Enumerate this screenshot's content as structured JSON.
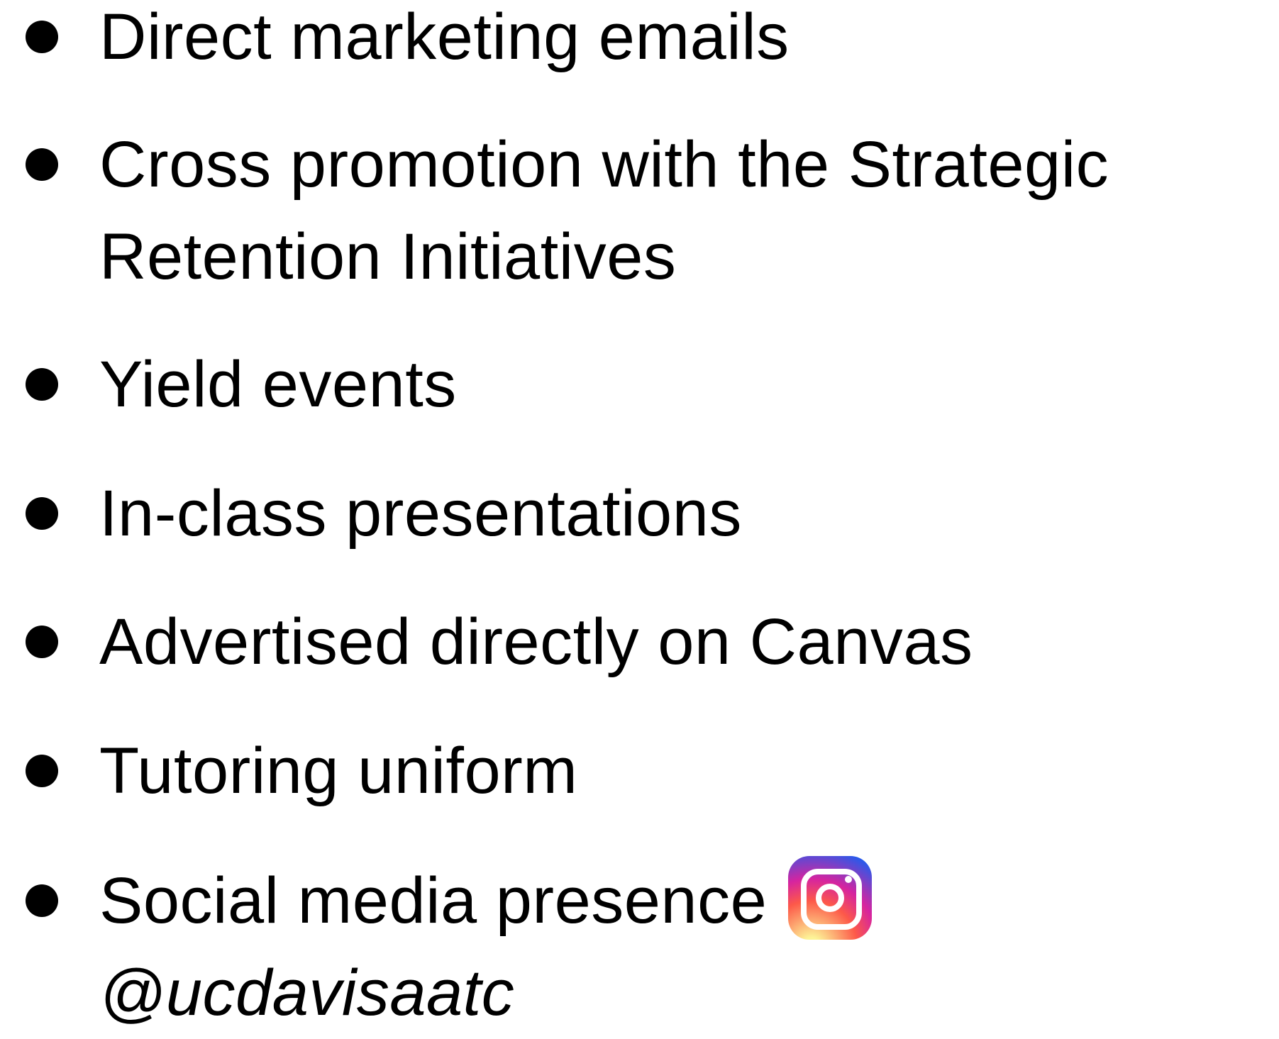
{
  "bullets": [
    {
      "text": "Direct marketing emails"
    },
    {
      "line1": "Cross promotion with the Strategic",
      "line2": "Retention Initiatives"
    },
    {
      "text": "Yield events"
    },
    {
      "text": "In-class presentations"
    },
    {
      "text": "Advertised directly on Canvas"
    },
    {
      "text": "Tutoring uniform"
    },
    {
      "line1": "Social media presence",
      "handle": "@ucdavisaatc",
      "icon": "instagram-icon"
    }
  ],
  "colors": {
    "text": "#000000",
    "background": "#ffffff",
    "instagram_gradient": [
      "#fdf497",
      "#fd5949",
      "#d6249f",
      "#285aeb"
    ]
  }
}
